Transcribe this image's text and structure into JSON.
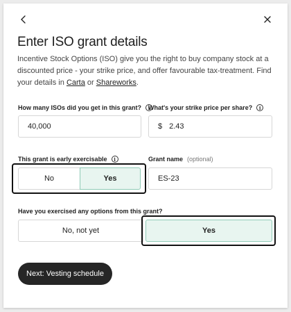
{
  "header": {
    "back_icon": "chevron-left-icon",
    "close_icon": "close-icon",
    "title": "Enter ISO grant details"
  },
  "description": {
    "text": "Incentive Stock Options (ISO) give you the right to buy company stock at a discounted price - your strike price, and offer favourable tax-treatment. Find your details in ",
    "link_carta": "Carta",
    "connector": " or ",
    "link_shareworks": "Shareworks",
    "end": "."
  },
  "fields": {
    "iso_count": {
      "label": "How many ISOs did you get in this grant?",
      "value": "40,000"
    },
    "strike_price": {
      "label": "What's your strike price per share?",
      "currency": "$",
      "value": "2.43"
    },
    "early_exercisable": {
      "label": "This grant is early exercisable",
      "options": [
        "No",
        "Yes"
      ],
      "selected": "Yes"
    },
    "grant_name": {
      "label": "Grant name",
      "optional": "(optional)",
      "value": "ES-23"
    },
    "exercised": {
      "label": "Have you exercised any options from this grant?",
      "options": [
        "No, not yet",
        "Yes"
      ],
      "selected": "Yes"
    }
  },
  "footer": {
    "next_label": "Next: Vesting schedule"
  },
  "colors": {
    "selected_bg": "#e8f5f0",
    "selected_border": "#8fcab6",
    "primary_button": "#262626"
  }
}
